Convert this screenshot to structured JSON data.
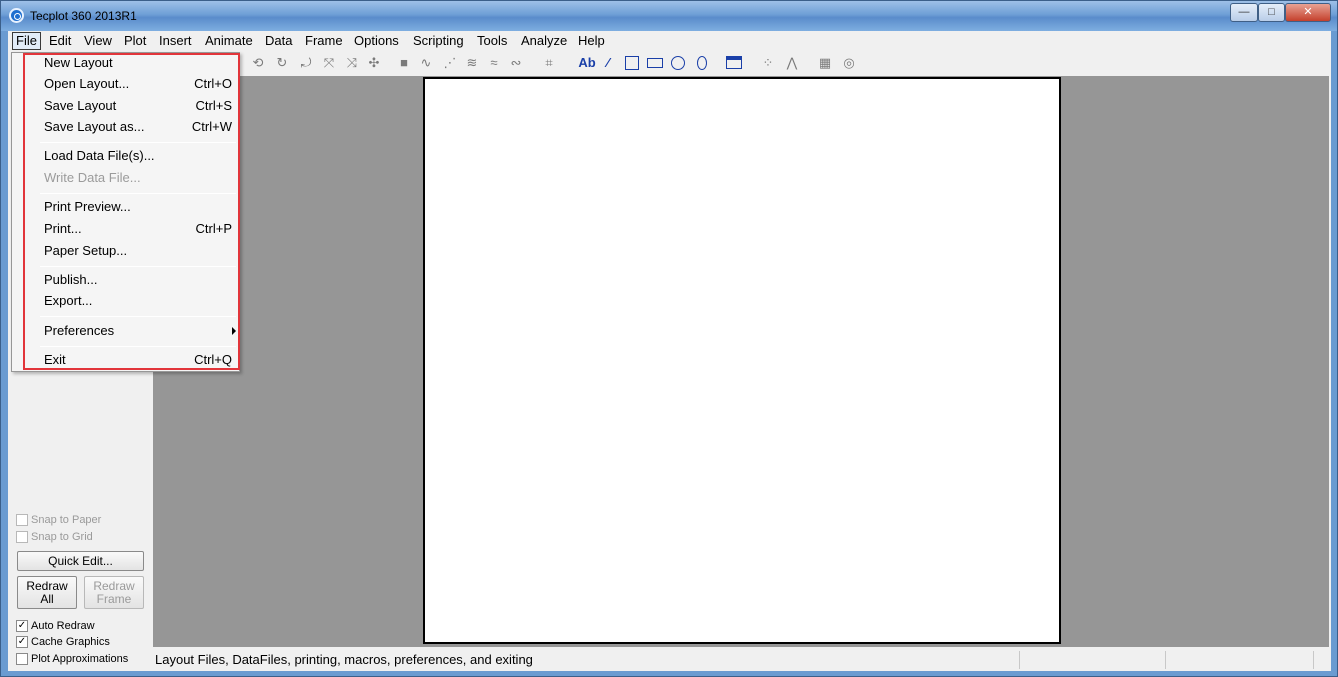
{
  "window": {
    "title": "Tecplot 360 2013R1",
    "min": "—",
    "max": "□",
    "close": "✕"
  },
  "menubar": [
    "File",
    "Edit",
    "View",
    "Plot",
    "Insert",
    "Animate",
    "Data",
    "Frame",
    "Options",
    "Scripting",
    "Tools",
    "Analyze",
    "Help"
  ],
  "file_menu": {
    "items": [
      {
        "label": "New Layout",
        "shortcut": ""
      },
      {
        "label": "Open Layout...",
        "shortcut": "Ctrl+O"
      },
      {
        "label": "Save Layout",
        "shortcut": "Ctrl+S"
      },
      {
        "label": "Save Layout as...",
        "shortcut": "Ctrl+W"
      },
      {
        "label": "Load Data File(s)...",
        "shortcut": ""
      },
      {
        "label": "Write Data File...",
        "shortcut": "",
        "disabled": true
      },
      {
        "label": "Print Preview...",
        "shortcut": ""
      },
      {
        "label": "Print...",
        "shortcut": "Ctrl+P"
      },
      {
        "label": "Paper Setup...",
        "shortcut": ""
      },
      {
        "label": "Publish...",
        "shortcut": ""
      },
      {
        "label": "Export...",
        "shortcut": ""
      },
      {
        "label": "Preferences",
        "shortcut": "",
        "submenu": true
      },
      {
        "label": "Exit",
        "shortcut": "Ctrl+Q"
      }
    ]
  },
  "toolbar": {
    "text_tool": "Ab"
  },
  "left_panel": {
    "snap_to_paper": "Snap to Paper",
    "snap_to_grid": "Snap to Grid",
    "quick_edit": "Quick Edit...",
    "redraw_all": "Redraw\nAll",
    "redraw_frame": "Redraw\nFrame",
    "auto_redraw": "Auto Redraw",
    "cache_graphics": "Cache Graphics",
    "plot_approximations": "Plot Approximations",
    "check": "✓"
  },
  "status": {
    "text": "Layout Files, DataFiles, printing, macros, preferences, and exiting"
  },
  "colors": {
    "highlight": "#e2353a",
    "titlebar": "#6e9fd6",
    "workspace": "#969696"
  }
}
